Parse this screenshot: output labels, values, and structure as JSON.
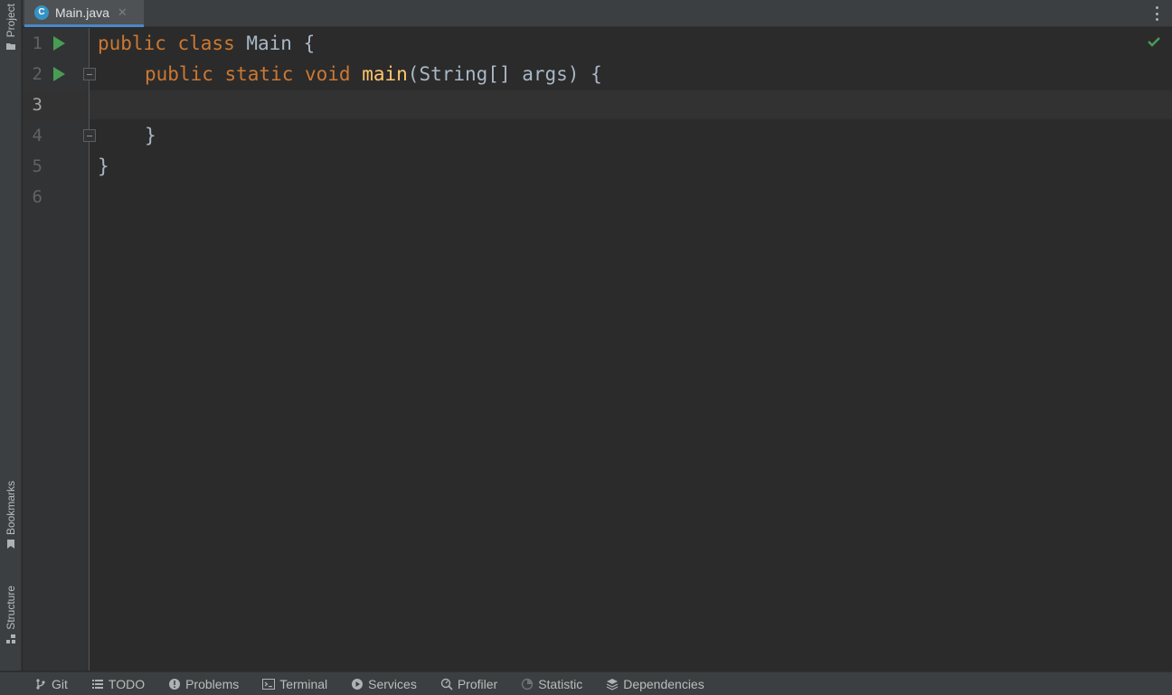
{
  "left_strip": {
    "project_label": "Project",
    "bookmarks_label": "Bookmarks",
    "structure_label": "Structure"
  },
  "tabs": {
    "active_file": "Main.java",
    "close_glyph": "✕",
    "file_icon": "java-class-icon"
  },
  "editor": {
    "inspection_status": "ok",
    "current_line": 3,
    "lines": [
      {
        "num": "1",
        "run": true,
        "fold": null
      },
      {
        "num": "2",
        "run": true,
        "fold": "open"
      },
      {
        "num": "3",
        "run": false,
        "fold": null
      },
      {
        "num": "4",
        "run": false,
        "fold": "close"
      },
      {
        "num": "5",
        "run": false,
        "fold": null
      },
      {
        "num": "6",
        "run": false,
        "fold": null
      }
    ],
    "code": {
      "l1_kw": "public class ",
      "l1_rest": "Main {",
      "l2_kw": "public static void ",
      "l2_fn": "main",
      "l2_rest": "(String[] args) {",
      "l4": "}",
      "l5": "}"
    }
  },
  "bottom_tools": {
    "git": "Git",
    "todo": "TODO",
    "problems": "Problems",
    "terminal": "Terminal",
    "services": "Services",
    "profiler": "Profiler",
    "statistic": "Statistic",
    "dependencies": "Dependencies"
  },
  "colors": {
    "keyword": "#cc7832",
    "function": "#ffc66d",
    "text": "#a9b7c6",
    "run": "#499c54",
    "ok": "#499c54"
  }
}
